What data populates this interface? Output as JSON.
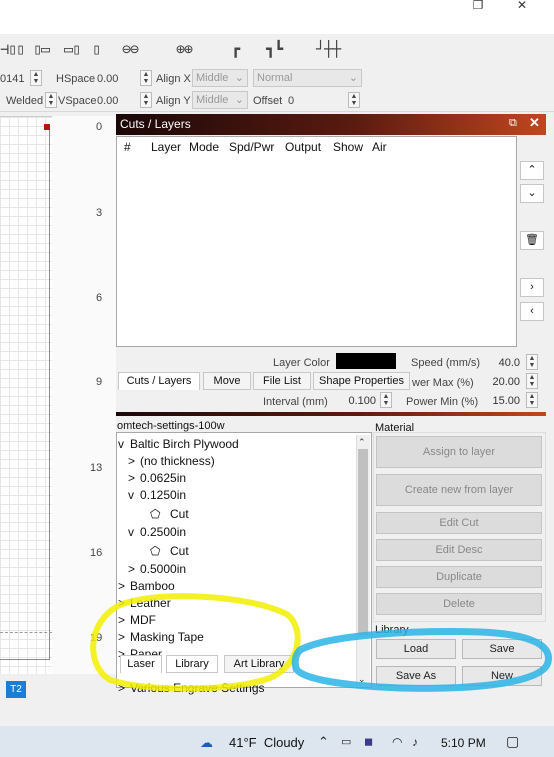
{
  "toolbar": {
    "align_icons": [
      "align-left-icon",
      "align-center-icon",
      "align-right-icon",
      "align-top-icon",
      "align-middle-icon",
      "align-bottom-icon",
      "distribute-h-icon",
      "distribute-v-icon",
      "make-same-width-icon",
      "make-same-height-icon"
    ]
  },
  "options": {
    "row1": {
      "value_left": "0141",
      "hspace_label": "HSpace",
      "hspace_value": "0.00",
      "alignx_label": "Align X",
      "alignx_value": "Middle",
      "mode_value": "Normal"
    },
    "row2": {
      "welded_label": "Welded",
      "vspace_label": "VSpace",
      "vspace_value": "0.00",
      "aligny_label": "Align Y",
      "aligny_value": "Middle",
      "offset_label": "Offset",
      "offset_value": "0"
    }
  },
  "ruler": {
    "ticks": [
      "0",
      "3",
      "6",
      "9",
      "13",
      "16",
      "19"
    ]
  },
  "cuts_layers": {
    "title": "Cuts / Layers",
    "columns": [
      "#",
      "Layer",
      "Mode",
      "Spd/Pwr",
      "Output",
      "Show",
      "Air"
    ],
    "layer_color_label": "Layer Color",
    "speed_label": "Speed (mm/s)",
    "speed_value": "40.0",
    "power_max_label": "wer Max (%)",
    "power_max_value": "20.00",
    "interval_label": "Interval (mm)",
    "interval_value": "0.100",
    "power_min_label": "Power Min (%)",
    "power_min_value": "15.00",
    "tabs": [
      "Cuts / Layers",
      "Move",
      "File List",
      "Shape Properties"
    ]
  },
  "library": {
    "file": "omtech-settings-100w",
    "tree": [
      {
        "label": "Baltic Birch Plywood",
        "toggle": "v"
      },
      {
        "label": "(no thickness)",
        "toggle": ">"
      },
      {
        "label": "0.0625in",
        "toggle": ">"
      },
      {
        "label": "0.1250in",
        "toggle": "v"
      },
      {
        "label": "Cut",
        "toggle": ""
      },
      {
        "label": "0.2500in",
        "toggle": "v"
      },
      {
        "label": "Cut",
        "toggle": ""
      },
      {
        "label": "0.5000in",
        "toggle": ">"
      },
      {
        "label": "Bamboo",
        "toggle": ">"
      },
      {
        "label": "Leather",
        "toggle": ">"
      },
      {
        "label": "MDF",
        "toggle": ">"
      },
      {
        "label": "Masking Tape",
        "toggle": ">"
      },
      {
        "label": "Paper",
        "toggle": ">"
      },
      {
        "label": "Various Engrave Settings",
        "toggle": ">"
      }
    ],
    "tabs": [
      "Laser",
      "Library",
      "Art Library"
    ]
  },
  "material": {
    "label": "Material",
    "buttons": [
      "Assign to layer",
      "Create new from layer",
      "Edit Cut",
      "Edit Desc",
      "Duplicate",
      "Delete"
    ],
    "library_label": "Library",
    "lib_buttons": [
      "Load",
      "Save",
      "Save As",
      "New"
    ]
  },
  "status": {
    "t2": "T2"
  },
  "taskbar": {
    "weather": "41°F  Cloudy",
    "time": "5:10 PM"
  },
  "colors": {
    "accent_orange": "#c2461e",
    "highlight_yellow": "#f2ee00",
    "highlight_blue": "#2ab4e6"
  }
}
